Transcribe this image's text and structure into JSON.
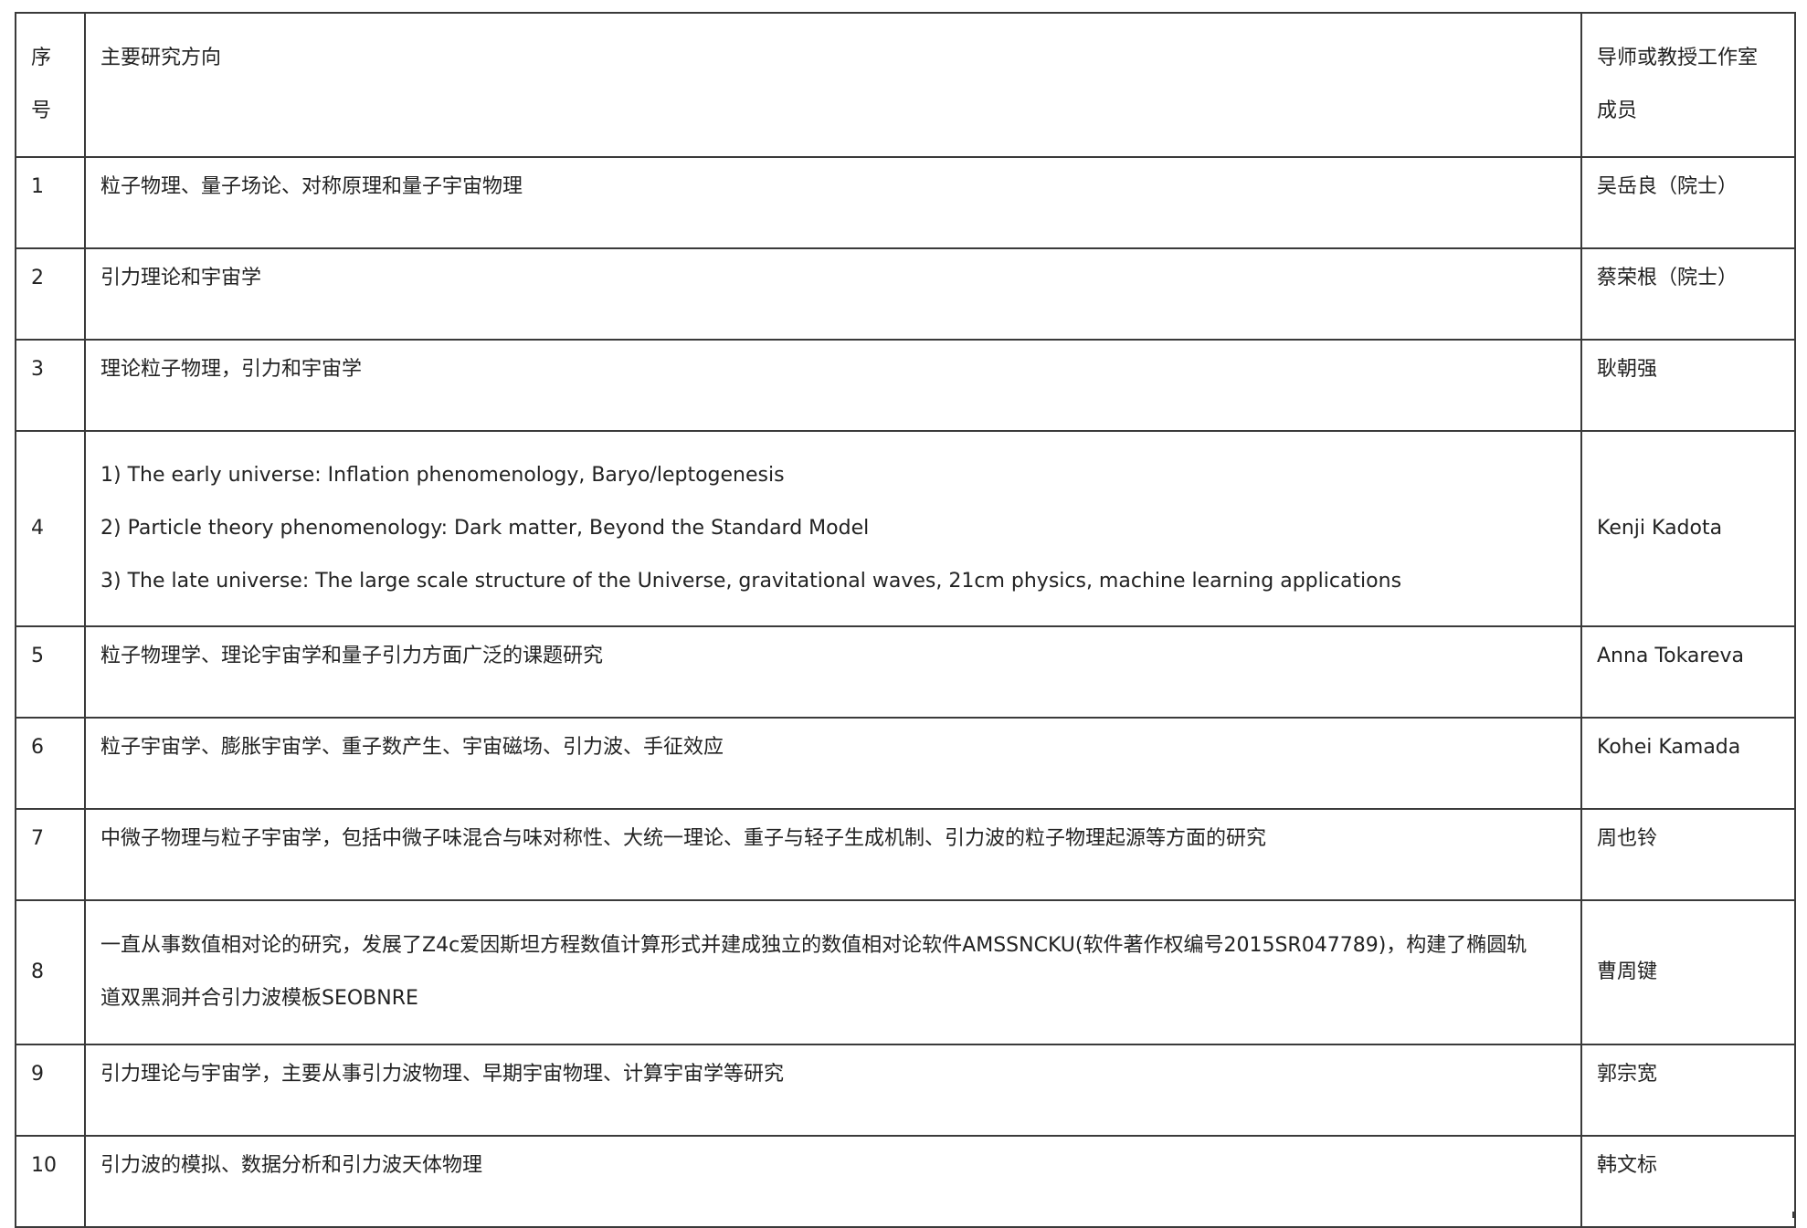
{
  "table": {
    "header": {
      "index_label": [
        "序",
        "号"
      ],
      "direction_label": "主要研究方向",
      "members_label": [
        "导师或教授工作室",
        "成员"
      ]
    },
    "rows": [
      {
        "index": "1",
        "direction": [
          "粒子物理、量子场论、对称原理和量子宇宙物理"
        ],
        "member": "吴岳良（院士）"
      },
      {
        "index": "2",
        "direction": [
          "引力理论和宇宙学"
        ],
        "member": "蔡荣根（院士）"
      },
      {
        "index": "3",
        "direction": [
          "理论粒子物理，引力和宇宙学"
        ],
        "member": "耿朝强"
      },
      {
        "index": "4",
        "direction": [
          "1) The early universe: Inflation phenomenology, Baryo/leptogenesis",
          "2) Particle theory phenomenology: Dark matter, Beyond the Standard Model",
          "3) The late universe: The large scale structure of the Universe, gravitational waves, 21cm physics, machine learning applications"
        ],
        "member": "Kenji Kadota"
      },
      {
        "index": "5",
        "direction": [
          "粒子物理学、理论宇宙学和量子引力方面广泛的课题研究"
        ],
        "member": "Anna Tokareva"
      },
      {
        "index": "6",
        "direction": [
          "粒子宇宙学、膨胀宇宙学、重子数产生、宇宙磁场、引力波、手征效应"
        ],
        "member": "Kohei Kamada"
      },
      {
        "index": "7",
        "direction": [
          "中微子物理与粒子宇宙学，包括中微子味混合与味对称性、大统一理论、重子与轻子生成机制、引力波的粒子物理起源等方面的研究"
        ],
        "member": "周也铃"
      },
      {
        "index": "8",
        "direction": [
          "一直从事数值相对论的研究，发展了Z4c爱因斯坦方程数值计算形式并建成独立的数值相对论软件AMSSNCKU(软件著作权编号2015SR047789)，构建了椭圆轨",
          "道双黑洞并合引力波模板SEOBNRE"
        ],
        "member": "曹周键"
      },
      {
        "index": "9",
        "direction": [
          "引力理论与宇宙学，主要从事引力波物理、早期宇宙物理、计算宇宙学等研究"
        ],
        "member": "郭宗宽"
      },
      {
        "index": "10",
        "direction": [
          "引力波的模拟、数据分析和引力波天体物理"
        ],
        "member": "韩文标"
      }
    ]
  }
}
